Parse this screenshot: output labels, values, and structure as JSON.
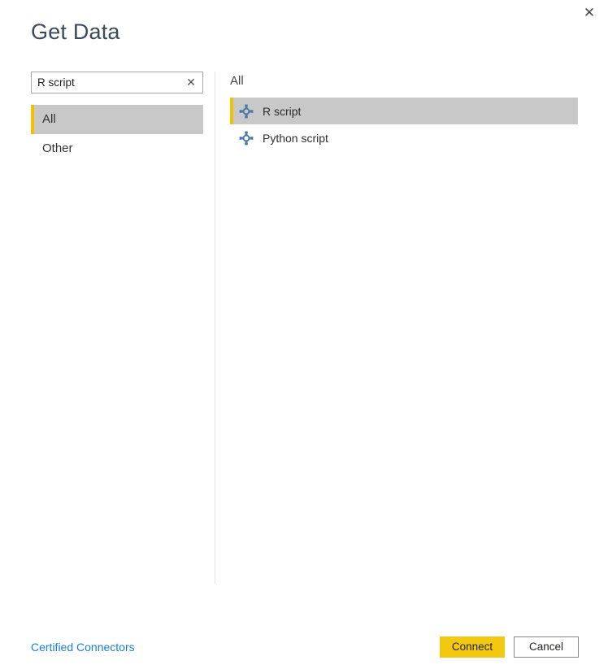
{
  "dialog": {
    "title": "Get Data",
    "close_label": "✕",
    "close_icon": "close-icon"
  },
  "search": {
    "value": "R script",
    "placeholder": "Search",
    "clear_label": "✕",
    "clear_icon": "clear-search-icon"
  },
  "categories": {
    "items": [
      {
        "label": "All",
        "selected": true
      },
      {
        "label": "Other",
        "selected": false
      }
    ]
  },
  "connectors": {
    "header": "All",
    "items": [
      {
        "label": "R script",
        "icon": "script-connector-icon",
        "selected": true
      },
      {
        "label": "Python script",
        "icon": "script-connector-icon",
        "selected": false
      }
    ]
  },
  "footer": {
    "certified_link": "Certified Connectors",
    "connect_label": "Connect",
    "cancel_label": "Cancel"
  },
  "colors": {
    "accent_yellow": "#f2c200",
    "primary_button": "#f2c811",
    "selection_gray": "#c8c8c8",
    "link_blue": "#1a7fd4",
    "icon_blue": "#4a77a8",
    "title_text": "#3b4a5a"
  }
}
